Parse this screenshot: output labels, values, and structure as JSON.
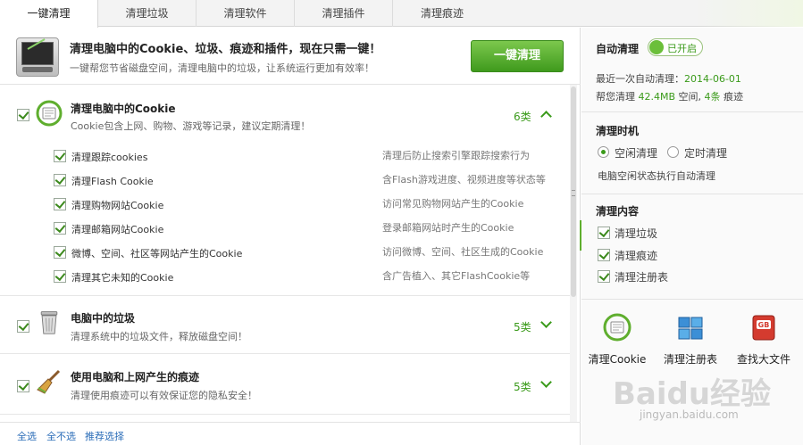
{
  "tabs": [
    {
      "label": "一键清理",
      "active": true
    },
    {
      "label": "清理垃圾",
      "active": false
    },
    {
      "label": "清理软件",
      "active": false
    },
    {
      "label": "清理插件",
      "active": false
    },
    {
      "label": "清理痕迹",
      "active": false
    }
  ],
  "header": {
    "title": "清理电脑中的Cookie、垃圾、痕迹和插件，现在只需一键！",
    "subtitle": "一键帮您节省磁盘空间，清理电脑中的垃圾，让系统运行更加有效率！",
    "clean_button": "一键清理"
  },
  "sections": [
    {
      "title": "清理电脑中的Cookie",
      "desc": "Cookie包含上网、购物、游戏等记录，建议定期清理！",
      "count": "6类",
      "expanded": true,
      "icon": "cookie-icon",
      "items": [
        {
          "label": "清理跟踪cookies",
          "desc": "清理后防止搜索引擎跟踪搜索行为"
        },
        {
          "label": "清理Flash Cookie",
          "desc": "含Flash游戏进度、视频进度等状态等"
        },
        {
          "label": "清理购物网站Cookie",
          "desc": "访问常见购物网站产生的Cookie"
        },
        {
          "label": "清理邮箱网站Cookie",
          "desc": "登录邮箱网站时产生的Cookie"
        },
        {
          "label": "微博、空间、社区等网站产生的Cookie",
          "desc": "访问微博、空间、社区生成的Cookie"
        },
        {
          "label": "清理其它未知的Cookie",
          "desc": "含广告植入、其它FlashCookie等"
        }
      ]
    },
    {
      "title": "电脑中的垃圾",
      "desc": "清理系统中的垃圾文件，释放磁盘空间！",
      "count": "5类",
      "expanded": false,
      "icon": "trash-bin-icon"
    },
    {
      "title": "使用电脑和上网产生的痕迹",
      "desc": "清理使用痕迹可以有效保证您的隐私安全！",
      "count": "5类",
      "expanded": false,
      "icon": "broom-icon"
    }
  ],
  "footer": {
    "select_all": "全选",
    "select_none": "全不选",
    "recommend": "推荐选择"
  },
  "right": {
    "auto_clean_label": "自动清理",
    "toggle_label": "已开启",
    "last_clean_prefix": "最近一次自动清理：",
    "last_clean_date": "2014-06-01",
    "help_prefix": "帮您清理 ",
    "help_size": "42.4MB",
    "help_mid": " 空间, ",
    "help_count": "4条",
    "help_suffix": " 痕迹",
    "timing_label": "清理时机",
    "radio_idle": "空闲清理",
    "radio_timed": "定时清理",
    "timing_note": "电脑空闲状态执行自动清理",
    "content_label": "清理内容",
    "content_items": [
      "清理垃圾",
      "清理痕迹",
      "清理注册表"
    ],
    "tools": [
      {
        "label": "清理Cookie",
        "icon": "cookie-icon"
      },
      {
        "label": "清理注册表",
        "icon": "registry-cubes-icon"
      },
      {
        "label": "查找大文件",
        "icon": "big-file-icon"
      }
    ]
  },
  "watermark": {
    "main": "Baidu经验",
    "sub": "jingyan.baidu.com"
  },
  "colors": {
    "accent_green": "#3a9a1a",
    "button_green": "#5fae2e",
    "link_blue": "#2b6db8"
  }
}
